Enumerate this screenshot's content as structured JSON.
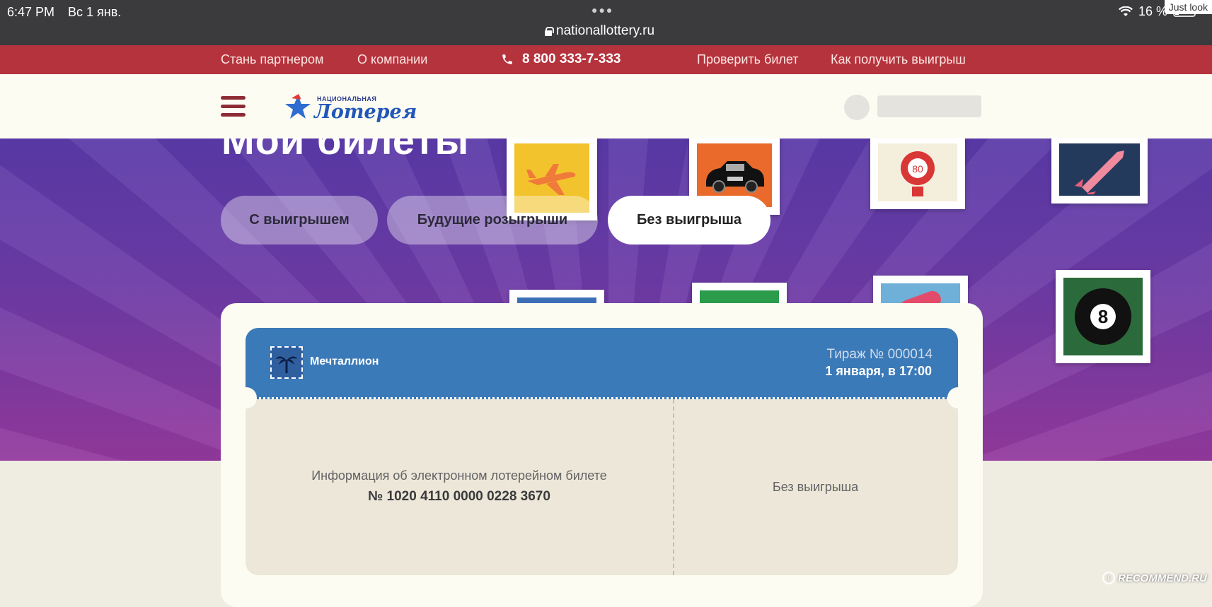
{
  "status_bar": {
    "time": "6:47 PM",
    "date": "Вс 1 янв.",
    "url": "nationallottery.ru",
    "battery": "16 %",
    "watermark": "Just look"
  },
  "top_nav": {
    "links": [
      "Стань партнером",
      "О компании",
      "Проверить билет",
      "Как получить выигрыш"
    ],
    "phone": "8 800 333-7-333",
    "background_color": "#b5333d"
  },
  "header": {
    "logo_top": "НАЦИОНАЛЬНАЯ",
    "logo_main": "Лотерея"
  },
  "hero": {
    "title": "Мои билеты",
    "tabs": [
      {
        "label": "С выигрышем",
        "active": false
      },
      {
        "label": "Будущие розыгрыши",
        "active": false
      },
      {
        "label": "Без выигрыша",
        "active": true
      }
    ],
    "stamps": [
      "plane",
      "car",
      "lantern-80",
      "rocket",
      "billiard-8",
      "stamp-blue",
      "stamp-green",
      "stamp-red"
    ]
  },
  "ticket": {
    "game_name": "Мечталлион",
    "draw_number": "Тираж № 000014",
    "draw_date": "1 января, в 17:00",
    "info_label": "Информация об электронном лотерейном билете",
    "ticket_number": "№ 1020 4110 0000 0228 3670",
    "result": "Без выигрыша",
    "accent_color": "#3b7ab8"
  },
  "watermark_bottom": "RECOMMEND.RU"
}
